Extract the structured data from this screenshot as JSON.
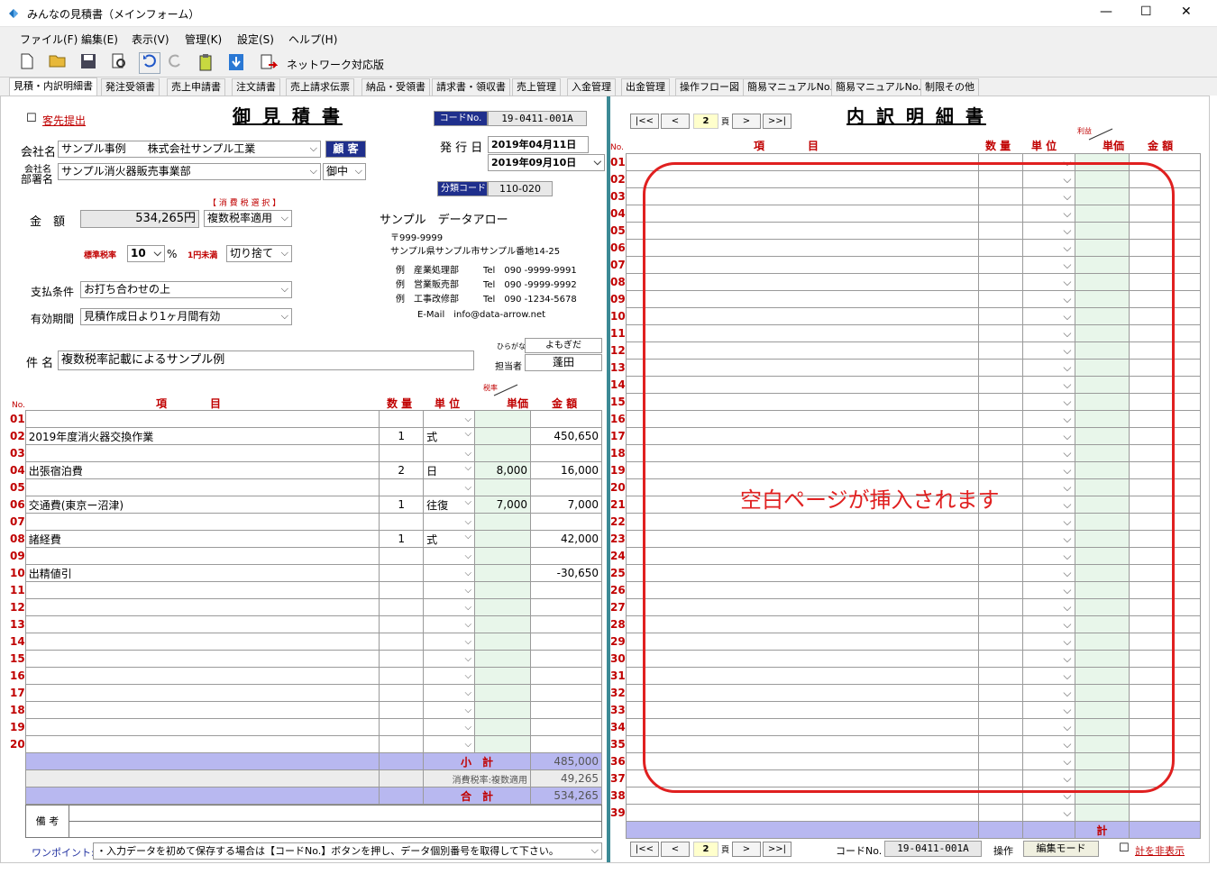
{
  "window": {
    "title": "みんなの見積書（メインフォーム）",
    "min": "—",
    "max": "☐",
    "close": "✕"
  },
  "menu": [
    "ファイル(F)",
    "編集(E)",
    "表示(V)",
    "管理(K)",
    "設定(S)",
    "ヘルプ(H)"
  ],
  "toolbar": {
    "network_label": "ネットワーク対応版"
  },
  "tabs": [
    "見積・内訳明細書",
    "発注受領書",
    "売上申請書",
    "注文請書",
    "売上請求伝票",
    "納品・受領書",
    "請求書・領収書",
    "売上管理",
    "入金管理",
    "出金管理",
    "操作フロー図",
    "簡易マニュアルNo.1",
    "簡易マニュアルNo.2",
    "制限その他"
  ],
  "estimate": {
    "title": "御 見 積 書",
    "send_label": "客先提出",
    "code_btn": "コードNo.",
    "code_value": "19-0411-001A",
    "issue_label": "発 行 日",
    "issue_date": "2019年04月11日",
    "issue_date2": "2019年09月10日",
    "cat_btn": "分類コード",
    "cat_value": "110-020",
    "company_label": "会社名",
    "company_value": "サンプル事例　　株式会社サンプル工業",
    "customer_btn": "顧 客",
    "dept_label1": "会社名",
    "dept_label2": "部署名",
    "dept_value": "サンプル消火器販売事業部",
    "honor": "御中",
    "tax_select_label": "【 消 費 税 選 択 】",
    "amount_label": "金　額",
    "amount_value": "534,265円",
    "tax_mode": "複数税率適用",
    "std_rate_label": "標準税率",
    "std_rate": "10",
    "pct": "%",
    "round_label": "1円未満",
    "round_mode": "切り捨て",
    "pay_label": "支払条件",
    "pay_value": "お打ち合わせの上",
    "valid_label": "有効期間",
    "valid_value": "見積作成日より1ヶ月間有効",
    "sender": {
      "name": "サンプル　データアロー",
      "zip": "〒999-9999",
      "addr": "サンプル県サンプル市サンプル番地14-25",
      "lines": [
        [
          "例　産業処理部",
          "Tel　090 -9999-9991"
        ],
        [
          "例　営業販売部",
          "Tel　090 -9999-9992"
        ],
        [
          "例　工事改修部",
          "Tel　090 -1234-5678"
        ]
      ],
      "email": "E-Mail　info@data-arrow.net"
    },
    "subject_label": "件 名",
    "subject_value": "複数税率記載によるサンプル例",
    "kana_label": "ひらがな",
    "kana_value": "よもぎだ",
    "person_label": "担当者",
    "person_value": "蓬田",
    "head": {
      "no": "No.",
      "item": "項　　　　目",
      "qty": "数 量",
      "unit": "単 位",
      "rate": "税率",
      "price": "単価",
      "amount": "金 額"
    },
    "rows": [
      {
        "n": "01",
        "item": "",
        "qty": "",
        "unit": "",
        "price": "",
        "amount": ""
      },
      {
        "n": "02",
        "item": "2019年度消火器交換作業",
        "qty": "1",
        "unit": "式",
        "price": "",
        "amount": "450,650"
      },
      {
        "n": "03",
        "item": "",
        "qty": "",
        "unit": "",
        "price": "",
        "amount": ""
      },
      {
        "n": "04",
        "item": "出張宿泊費",
        "qty": "2",
        "unit": "日",
        "price": "8,000",
        "amount": "16,000"
      },
      {
        "n": "05",
        "item": "",
        "qty": "",
        "unit": "",
        "price": "",
        "amount": ""
      },
      {
        "n": "06",
        "item": "交通費(東京ー沼津)",
        "qty": "1",
        "unit": "往復",
        "price": "7,000",
        "amount": "7,000"
      },
      {
        "n": "07",
        "item": "",
        "qty": "",
        "unit": "",
        "price": "",
        "amount": ""
      },
      {
        "n": "08",
        "item": "諸経費",
        "qty": "1",
        "unit": "式",
        "price": "",
        "amount": "42,000"
      },
      {
        "n": "09",
        "item": "",
        "qty": "",
        "unit": "",
        "price": "",
        "amount": ""
      },
      {
        "n": "10",
        "item": "出精値引",
        "qty": "",
        "unit": "",
        "price": "",
        "amount": "-30,650"
      },
      {
        "n": "11",
        "item": "",
        "qty": "",
        "unit": "",
        "price": "",
        "amount": ""
      },
      {
        "n": "12",
        "item": "",
        "qty": "",
        "unit": "",
        "price": "",
        "amount": ""
      },
      {
        "n": "13",
        "item": "",
        "qty": "",
        "unit": "",
        "price": "",
        "amount": ""
      },
      {
        "n": "14",
        "item": "",
        "qty": "",
        "unit": "",
        "price": "",
        "amount": ""
      },
      {
        "n": "15",
        "item": "",
        "qty": "",
        "unit": "",
        "price": "",
        "amount": ""
      },
      {
        "n": "16",
        "item": "",
        "qty": "",
        "unit": "",
        "price": "",
        "amount": ""
      },
      {
        "n": "17",
        "item": "",
        "qty": "",
        "unit": "",
        "price": "",
        "amount": ""
      },
      {
        "n": "18",
        "item": "",
        "qty": "",
        "unit": "",
        "price": "",
        "amount": ""
      },
      {
        "n": "19",
        "item": "",
        "qty": "",
        "unit": "",
        "price": "",
        "amount": ""
      },
      {
        "n": "20",
        "item": "",
        "qty": "",
        "unit": "",
        "price": "",
        "amount": ""
      }
    ],
    "subtotal_label": "小　計",
    "subtotal": "485,000",
    "tax_label": "消費税率:複数適用",
    "tax": "49,265",
    "total_label": "合　計",
    "total": "534,265",
    "remarks_label": "備 考",
    "tip_label": "ワンポイント:",
    "tip_text": "・入力データを初めて保存する場合は【コードNo.】ボタンを押し、データ個別番号を取得して下さい。"
  },
  "detail": {
    "title": "内 訳 明 細 書",
    "page": "2",
    "page_suffix": "頁",
    "nav": [
      "|<<",
      "<",
      ">",
      ">>|"
    ],
    "head": {
      "no": "No.",
      "item": "項　　　　目",
      "qty": "数 量",
      "unit": "単 位",
      "profit": "利益",
      "price": "単価",
      "amount": "金 額"
    },
    "rows": [
      "01",
      "02",
      "03",
      "04",
      "05",
      "06",
      "07",
      "08",
      "09",
      "10",
      "11",
      "12",
      "13",
      "14",
      "15",
      "16",
      "17",
      "18",
      "19",
      "20",
      "21",
      "22",
      "23",
      "24",
      "25",
      "26",
      "27",
      "28",
      "29",
      "30",
      "31",
      "32",
      "33",
      "34",
      "35",
      "36",
      "37",
      "38",
      "39"
    ],
    "total_label": "計",
    "message": "空白ページが挿入されます",
    "code_label": "コードNo.",
    "code_value": "19-0411-001A",
    "op_label": "操作",
    "op_value": "編集モード",
    "hide_label": "計を非表示"
  }
}
